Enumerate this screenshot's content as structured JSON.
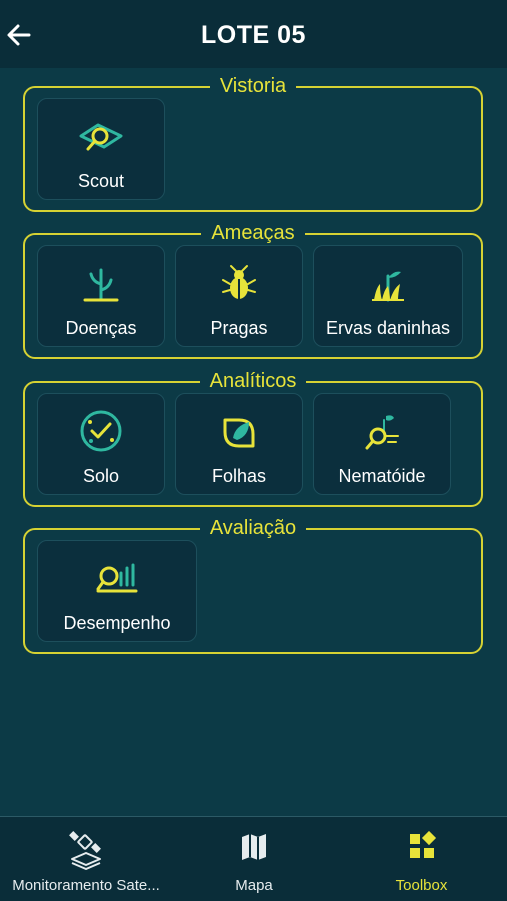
{
  "header": {
    "title": "LOTE 05"
  },
  "sections": [
    {
      "title": "Vistoria",
      "items": [
        {
          "label": "Scout",
          "icon": "scout-icon"
        }
      ]
    },
    {
      "title": "Ameaças",
      "items": [
        {
          "label": "Doenças",
          "icon": "sprout-disease-icon"
        },
        {
          "label": "Pragas",
          "icon": "bug-icon"
        },
        {
          "label": "Ervas daninhas",
          "icon": "weeds-icon"
        }
      ]
    },
    {
      "title": "Analíticos",
      "items": [
        {
          "label": "Solo",
          "icon": "soil-icon"
        },
        {
          "label": "Folhas",
          "icon": "leaf-icon"
        },
        {
          "label": "Nematóide",
          "icon": "nematode-icon"
        }
      ]
    },
    {
      "title": "Avaliação",
      "items": [
        {
          "label": "Desempenho",
          "icon": "performance-chart-icon"
        }
      ]
    }
  ],
  "tabbar": {
    "items": [
      {
        "label": "Monitoramento Sate...",
        "icon": "satellite-icon",
        "active": false
      },
      {
        "label": "Mapa",
        "icon": "map-icon",
        "active": false
      },
      {
        "label": "Toolbox",
        "icon": "toolbox-icon",
        "active": true
      }
    ]
  },
  "colors": {
    "background": "#0c3a46",
    "header": "#0a2d39",
    "accent": "#e7e33a",
    "icon_green": "#2fb8a0",
    "tile": "#0b2f3d"
  }
}
